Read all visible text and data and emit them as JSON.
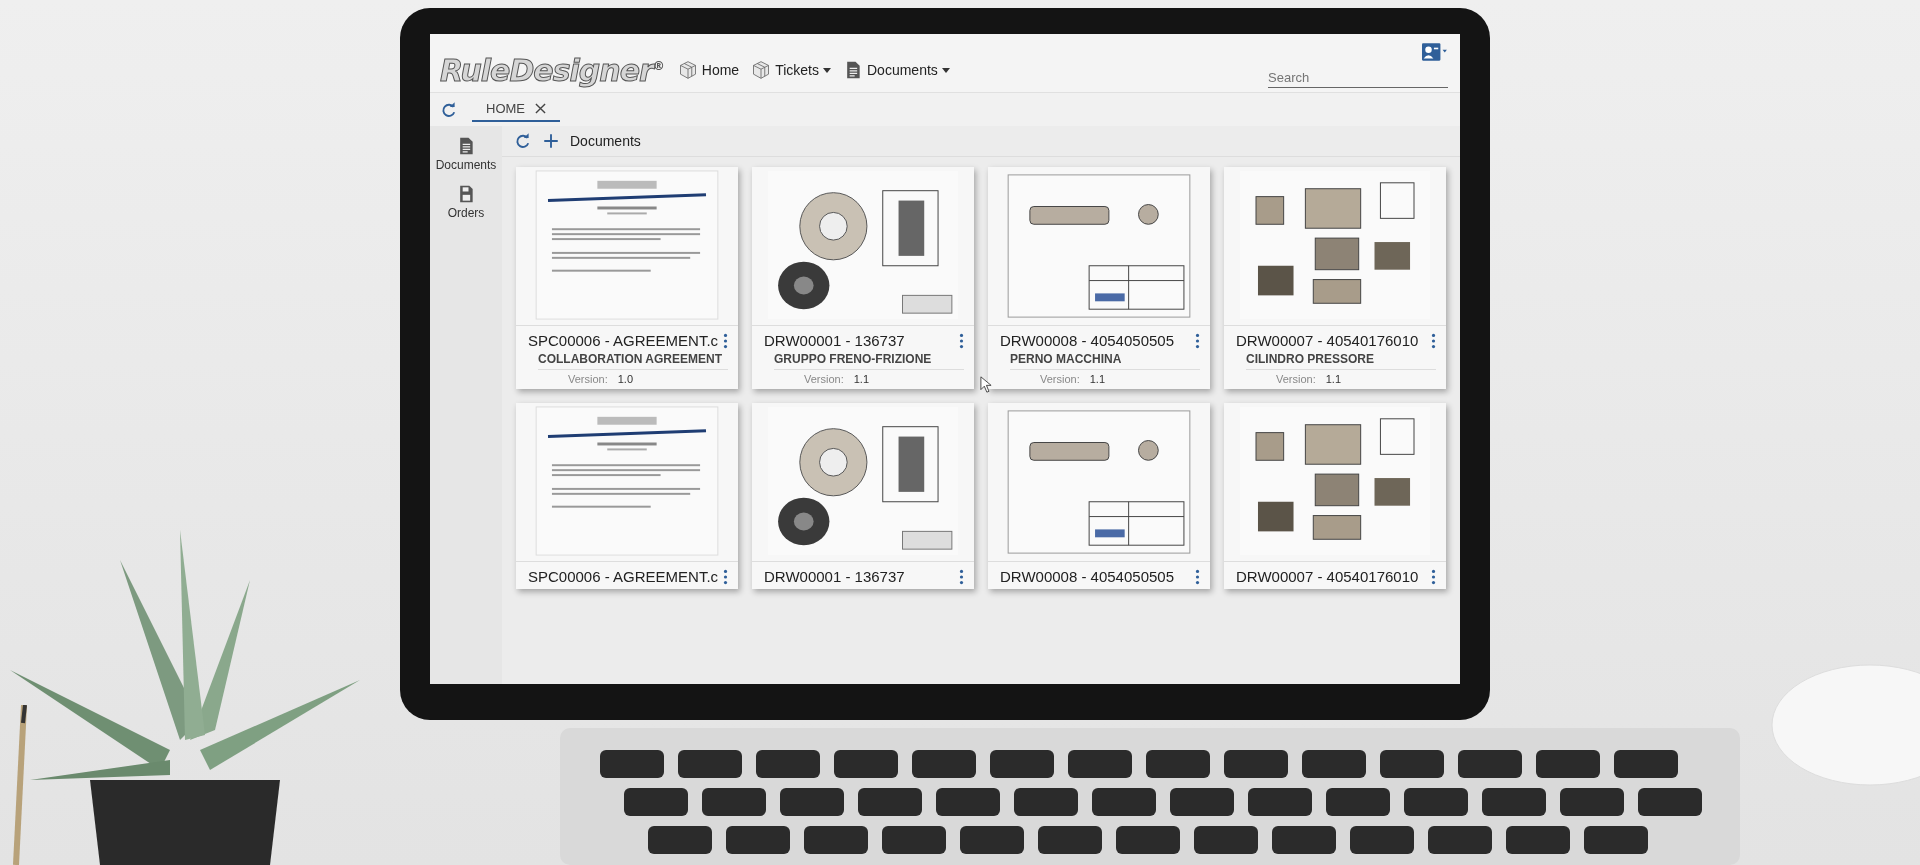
{
  "header": {
    "logo": "RuleDesigner$^{®}$",
    "nav": [
      {
        "label": "Home",
        "dropdown": false
      },
      {
        "label": "Tickets",
        "dropdown": true
      },
      {
        "label": "Documents",
        "dropdown": true
      }
    ],
    "search": {
      "placeholder": "Search"
    }
  },
  "tabs": [
    {
      "label": "HOME",
      "selected": true
    }
  ],
  "sidebar": {
    "items": [
      {
        "label": "Documents"
      },
      {
        "label": "Orders"
      }
    ]
  },
  "toolbar": {
    "title": "Documents"
  },
  "cards": [
    {
      "kind": "document",
      "title": "SPC00006 - AGREEMENT.c",
      "subtitle": "COLLABORATION AGREEMENT",
      "version_label": "Version:",
      "version": "1.0"
    },
    {
      "kind": "wheel",
      "title": "DRW00001 - 136737",
      "subtitle": "GRUPPO FRENO-FRIZIONE",
      "version_label": "Version:",
      "version": "1.1"
    },
    {
      "kind": "shaft",
      "title": "DRW00008 - 4054050505",
      "subtitle": "PERNO MACCHINA",
      "version_label": "Version:",
      "version": "1.1"
    },
    {
      "kind": "block",
      "title": "DRW00007 - 40540176010",
      "subtitle": "CILINDRO PRESSORE",
      "version_label": "Version:",
      "version": "1.1"
    },
    {
      "kind": "document",
      "title": "SPC00006 - AGREEMENT.c"
    },
    {
      "kind": "wheel",
      "title": "DRW00001 - 136737"
    },
    {
      "kind": "shaft",
      "title": "DRW00008 - 4054050505"
    },
    {
      "kind": "block",
      "title": "DRW00007 - 40540176010"
    }
  ]
}
